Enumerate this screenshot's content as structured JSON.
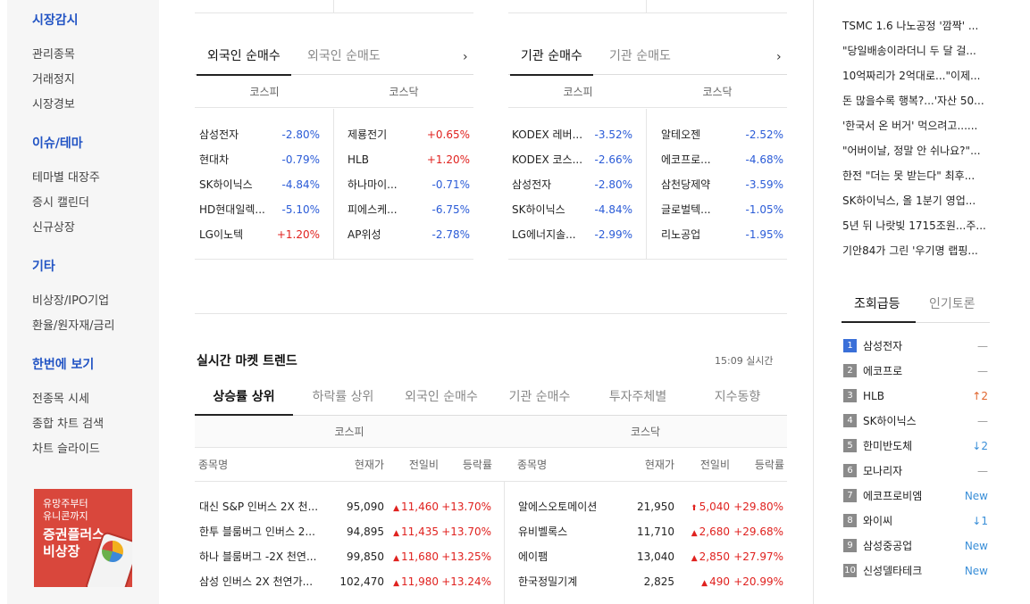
{
  "leftnav": {
    "sections": [
      {
        "title": "시장감시",
        "items": [
          "관리종목",
          "거래정지",
          "시장경보"
        ]
      },
      {
        "title": "이슈/테마",
        "items": [
          "테마별 대장주",
          "증시 캘린더",
          "신규상장"
        ]
      },
      {
        "title": "기타",
        "items": [
          "비상장/IPO기업",
          "환율/원자재/금리"
        ]
      },
      {
        "title": "한번에 보기",
        "items": [
          "전종목 시세",
          "종합 차트 검색",
          "차트 슬라이드"
        ]
      }
    ],
    "promo": {
      "line1": "유망주부터",
      "line2": "유니콘까지",
      "line3": "증권플러스",
      "line4": "비상장"
    }
  },
  "foreign": {
    "tabs": [
      "외국인 순매수",
      "외국인 순매도"
    ],
    "markets": [
      "코스피",
      "코스닥"
    ],
    "kospi": [
      {
        "name": "삼성전자",
        "pct": "-2.80%"
      },
      {
        "name": "현대차",
        "pct": "-0.79%"
      },
      {
        "name": "SK하이닉스",
        "pct": "-4.84%"
      },
      {
        "name": "HD현대일렉...",
        "pct": "-5.10%"
      },
      {
        "name": "LG이노텍",
        "pct": "+1.20%"
      }
    ],
    "kosdaq": [
      {
        "name": "제룡전기",
        "pct": "+0.65%"
      },
      {
        "name": "HLB",
        "pct": "+1.20%"
      },
      {
        "name": "하나마이...",
        "pct": "-0.71%"
      },
      {
        "name": "피에스케...",
        "pct": "-6.75%"
      },
      {
        "name": "AP위성",
        "pct": "-2.78%"
      }
    ]
  },
  "institution": {
    "tabs": [
      "기관 순매수",
      "기관 순매도"
    ],
    "markets": [
      "코스피",
      "코스닥"
    ],
    "kospi": [
      {
        "name": "KODEX 레버...",
        "pct": "-3.52%"
      },
      {
        "name": "KODEX 코스...",
        "pct": "-2.66%"
      },
      {
        "name": "삼성전자",
        "pct": "-2.80%"
      },
      {
        "name": "SK하이닉스",
        "pct": "-4.84%"
      },
      {
        "name": "LG에너지솔...",
        "pct": "-2.99%"
      }
    ],
    "kosdaq": [
      {
        "name": "알테오젠",
        "pct": "-2.52%"
      },
      {
        "name": "에코프로...",
        "pct": "-4.68%"
      },
      {
        "name": "삼천당제약",
        "pct": "-3.59%"
      },
      {
        "name": "글로벌텍...",
        "pct": "-1.05%"
      },
      {
        "name": "리노공업",
        "pct": "-1.95%"
      }
    ]
  },
  "trend": {
    "title": "실시간 마켓 트렌드",
    "time": "15:09 실시간",
    "tabs": [
      "상승률 상위",
      "하락률 상위",
      "외국인 순매수",
      "기관 순매수",
      "투자주체별",
      "지수동향"
    ],
    "markets": [
      "코스피",
      "코스닥"
    ],
    "columns": [
      "종목명",
      "현재가",
      "전일비",
      "등락률"
    ],
    "kospi": [
      {
        "name": "대신 S&P 인버스 2X 천...",
        "price": "95,090",
        "change": "11,460",
        "rate": "+13.70%"
      },
      {
        "name": "한투 블룸버그 인버스 2...",
        "price": "94,895",
        "change": "11,435",
        "rate": "+13.70%"
      },
      {
        "name": "하나 블룸버그 -2X 천연...",
        "price": "99,850",
        "change": "11,680",
        "rate": "+13.25%"
      },
      {
        "name": "삼성 인버스 2X 천연가...",
        "price": "102,470",
        "change": "11,980",
        "rate": "+13.24%"
      }
    ],
    "kosdaq": [
      {
        "name": "알에스오토메이션",
        "price": "21,950",
        "change": "5,040",
        "rate": "+29.80%",
        "limit": true
      },
      {
        "name": "유비벨록스",
        "price": "11,710",
        "change": "2,680",
        "rate": "+29.68%",
        "limit": false
      },
      {
        "name": "에이팸",
        "price": "13,040",
        "change": "2,850",
        "rate": "+27.97%",
        "limit": false
      },
      {
        "name": "한국정밀기계",
        "price": "2,825",
        "change": "490",
        "rate": "+20.99%",
        "limit": false
      }
    ]
  },
  "news": [
    "TSMC 1.6 나노공정 '깜짝' ...",
    "\"당일배송이라더니 두 달 걸...",
    "10억짜리가 2억대로...\"이제...",
    "돈 많을수록 행복?...'자산 50...",
    "'한국서 온 버거' 먹으려고......",
    "\"어버이날, 정말 안 쉬나요?\"...",
    "한전 \"더는 못 받는다\" 최후...",
    "SK하이닉스, 올 1분기 영업...",
    "5년 뒤 나랏빚 1715조원...주...",
    "기안84가 그린 '우기명 랩핑..."
  ],
  "ranking": {
    "tabs": [
      "조회급등",
      "인기토론"
    ],
    "items": [
      {
        "rank": "1",
        "name": "삼성전자",
        "change": "—",
        "kind": "same"
      },
      {
        "rank": "2",
        "name": "에코프로",
        "change": "—",
        "kind": "same"
      },
      {
        "rank": "3",
        "name": "HLB",
        "change": "2",
        "kind": "rise"
      },
      {
        "rank": "4",
        "name": "SK하이닉스",
        "change": "—",
        "kind": "same"
      },
      {
        "rank": "5",
        "name": "한미반도체",
        "change": "2",
        "kind": "fall"
      },
      {
        "rank": "6",
        "name": "모나리자",
        "change": "—",
        "kind": "same"
      },
      {
        "rank": "7",
        "name": "에코프로비엠",
        "change": "New",
        "kind": "new"
      },
      {
        "rank": "8",
        "name": "와이씨",
        "change": "1",
        "kind": "fall"
      },
      {
        "rank": "9",
        "name": "삼성중공업",
        "change": "New",
        "kind": "new"
      },
      {
        "rank": "10",
        "name": "신성델타테크",
        "change": "New",
        "kind": "new"
      }
    ]
  },
  "colors": {
    "nav_title": "#2254c4",
    "up": "#e0221f",
    "down": "#2a5bd7",
    "promo_bg": "#d9473c",
    "rank_first": "#3a6fd8"
  }
}
